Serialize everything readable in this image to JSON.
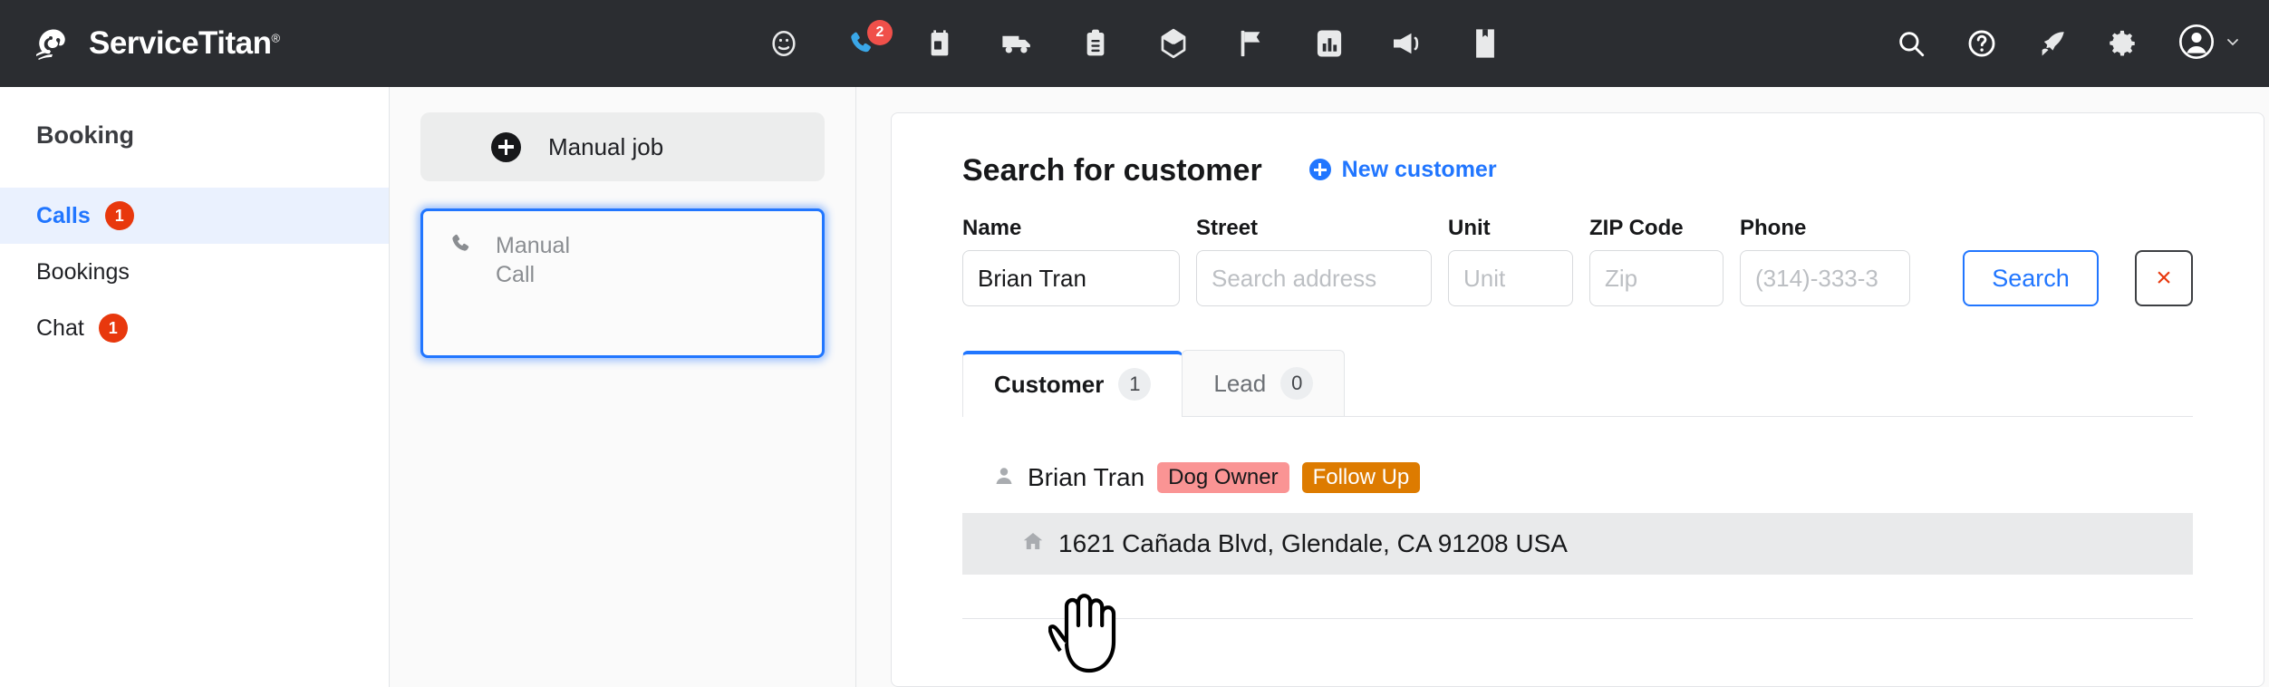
{
  "brand": {
    "name": "ServiceTitan",
    "registered": "®",
    "logo_icon": "titan-head-logo"
  },
  "topnav": {
    "items": [
      {
        "icon": "dashboard-gauge-icon",
        "badge": null,
        "active": false
      },
      {
        "icon": "phone-icon",
        "badge": "2",
        "active": true
      },
      {
        "icon": "calendar-icon",
        "badge": null,
        "active": false
      },
      {
        "icon": "truck-icon",
        "badge": null,
        "active": false
      },
      {
        "icon": "clipboard-icon",
        "badge": null,
        "active": false
      },
      {
        "icon": "box-package-icon",
        "badge": null,
        "active": false
      },
      {
        "icon": "flag-icon",
        "badge": null,
        "active": false
      },
      {
        "icon": "bar-chart-icon",
        "badge": null,
        "active": false
      },
      {
        "icon": "megaphone-icon",
        "badge": null,
        "active": false
      },
      {
        "icon": "book-icon",
        "badge": null,
        "active": false
      }
    ],
    "right_items": [
      {
        "icon": "search-icon"
      },
      {
        "icon": "help-question-icon"
      },
      {
        "icon": "rocket-icon"
      },
      {
        "icon": "gear-icon"
      },
      {
        "icon": "avatar-icon"
      },
      {
        "icon": "chevron-down-icon"
      }
    ]
  },
  "sidebar": {
    "title": "Booking",
    "items": [
      {
        "label": "Calls",
        "badge": "1",
        "active": true
      },
      {
        "label": "Bookings",
        "badge": null,
        "active": false
      },
      {
        "label": "Chat",
        "badge": "1",
        "active": false
      }
    ]
  },
  "calls_panel": {
    "manual_job_label": "Manual job",
    "card": {
      "line1": "Manual",
      "line2": "Call",
      "icon": "phone-icon"
    }
  },
  "search": {
    "title": "Search for customer",
    "new_customer_label": "New customer",
    "fields": {
      "name": {
        "label": "Name",
        "value": "Brian Tran",
        "placeholder": "Name"
      },
      "street": {
        "label": "Street",
        "value": "",
        "placeholder": "Search address"
      },
      "unit": {
        "label": "Unit",
        "value": "",
        "placeholder": "Unit"
      },
      "zip": {
        "label": "ZIP Code",
        "value": "",
        "placeholder": "Zip"
      },
      "phone": {
        "label": "Phone",
        "value": "",
        "placeholder": "(314)-333-3"
      }
    },
    "search_button": "Search",
    "clear_button": "×"
  },
  "tabs": [
    {
      "label": "Customer",
      "count": "1",
      "active": true
    },
    {
      "label": "Lead",
      "count": "0",
      "active": false
    }
  ],
  "results": [
    {
      "name": "Brian Tran",
      "tags": [
        {
          "label": "Dog Owner",
          "color": "#fa9494"
        },
        {
          "label": "Follow Up",
          "color": "#dd7b00"
        }
      ],
      "address": "1621 Cañada Blvd, Glendale, CA 91208 USA"
    }
  ],
  "colors": {
    "topbar_bg": "#2b2d31",
    "accent_blue": "#2176ff",
    "badge_red": "#e8380d",
    "nav_badge_red": "#f0504a",
    "active_phone_blue": "#3aa7e8"
  }
}
